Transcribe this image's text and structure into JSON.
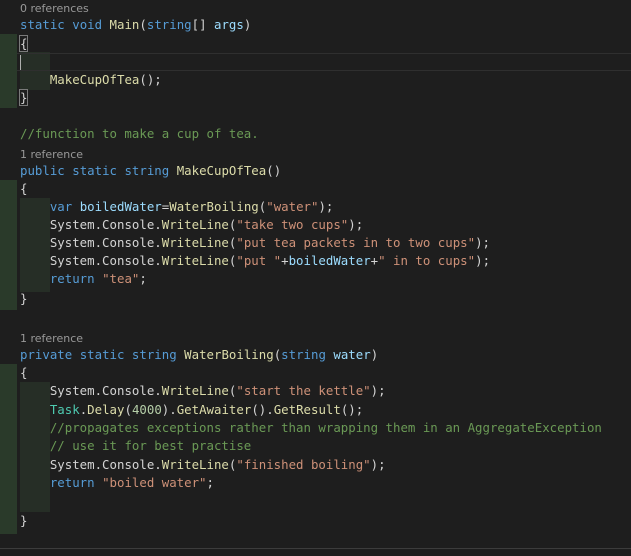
{
  "editor": {
    "language": "csharp",
    "theme_colors": {
      "background": "#1e1e1e",
      "keyword": "#569cd6",
      "function": "#dcdcaa",
      "string": "#ce9178",
      "number": "#b5cea8",
      "comment": "#6a9955",
      "variable": "#9cdcfe",
      "type": "#4ec9b0",
      "plain": "#d4d4d4",
      "codelens": "#999999"
    },
    "codelens": {
      "main": "0 references",
      "make_cup": "1 reference",
      "water_boiling": "1 reference"
    },
    "main_block": {
      "sig_kw1": "static",
      "sig_kw2": "void",
      "sig_name": "Main",
      "sig_open": "(",
      "sig_type": "string",
      "sig_brackets": "[]",
      "sig_param": "args",
      "sig_close": ")",
      "open_brace": "{",
      "call_name": "MakeCupOfTea",
      "call_rest": "();",
      "close_brace": "}"
    },
    "comment_line": "//function to make a cup of tea.",
    "make_cup_block": {
      "sig_kw1": "public",
      "sig_kw2": "static",
      "sig_kw3": "string",
      "sig_name": "MakeCupOfTea",
      "sig_rest": "()",
      "open_brace": "{",
      "l1_kw": "var",
      "l1_var": "boiledWater",
      "l1_eq": "=",
      "l1_fn": "WaterBoiling",
      "l1_open": "(",
      "l1_str": "\"water\"",
      "l1_close": ");",
      "l2_prefix": "System.Console.",
      "l2_fn": "WriteLine",
      "l2_open": "(",
      "l2_str": "\"take two cups\"",
      "l2_close": ");",
      "l3_prefix": "System.Console.",
      "l3_fn": "WriteLine",
      "l3_open": "(",
      "l3_str": "\"put tea packets in to two cups\"",
      "l3_close": ");",
      "l4_prefix": "System.Console.",
      "l4_fn": "WriteLine",
      "l4_open": "(",
      "l4_str1": "\"put \"",
      "l4_plus1": "+",
      "l4_var": "boiledWater",
      "l4_plus2": "+",
      "l4_str2": "\" in to cups\"",
      "l4_close": ");",
      "l5_kw": "return",
      "l5_str": "\"tea\"",
      "l5_end": ";",
      "close_brace": "}"
    },
    "water_block": {
      "sig_kw1": "private",
      "sig_kw2": "static",
      "sig_kw3": "string",
      "sig_name": "WaterBoiling",
      "sig_open": "(",
      "sig_type": "string",
      "sig_param": "water",
      "sig_close": ")",
      "open_brace": "{",
      "l1_prefix": "System.Console.",
      "l1_fn": "WriteLine",
      "l1_open": "(",
      "l1_str": "\"start the kettle\"",
      "l1_close": ");",
      "l2_type": "Task",
      "l2_dot": ".",
      "l2_fn1": "Delay",
      "l2_open": "(",
      "l2_num": "4000",
      "l2_mid": ").",
      "l2_fn2": "GetAwaiter",
      "l2_mid2": "().",
      "l2_fn3": "GetResult",
      "l2_close": "();",
      "l3_cmt": "//propagates exceptions rather than wrapping them in an AggregateException",
      "l4_cmt": "// use it for best practise",
      "l5_prefix": "System.Console.",
      "l5_fn": "WriteLine",
      "l5_open": "(",
      "l5_str": "\"finished boiling\"",
      "l5_close": ");",
      "l6_kw": "return",
      "l6_str": "\"boiled water\"",
      "l6_end": ";",
      "close_brace": "}"
    }
  }
}
